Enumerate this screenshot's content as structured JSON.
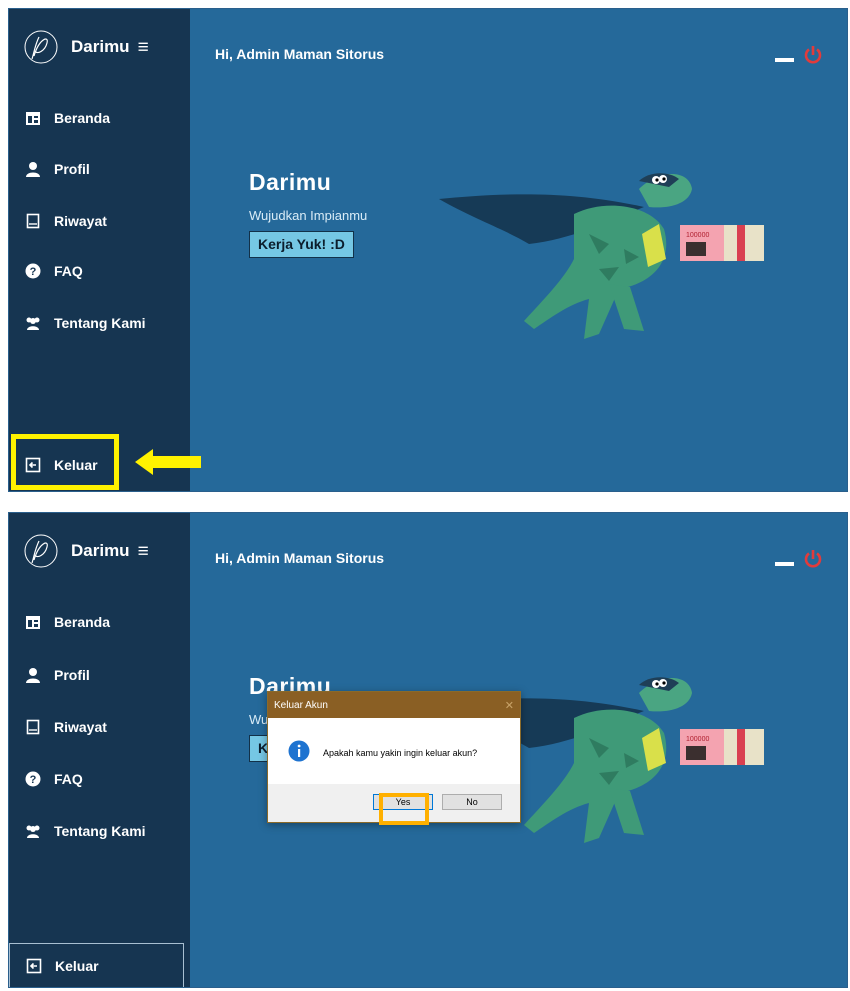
{
  "app": {
    "brand": "Darimu",
    "greeting": "Hi, Admin Maman Sitorus"
  },
  "sidebar": {
    "items": [
      {
        "label": "Beranda",
        "icon": "calendar-icon"
      },
      {
        "label": "Profil",
        "icon": "user-icon"
      },
      {
        "label": "Riwayat",
        "icon": "document-icon"
      },
      {
        "label": "FAQ",
        "icon": "question-icon"
      },
      {
        "label": "Tentang Kami",
        "icon": "users-icon"
      }
    ],
    "logout": "Keluar"
  },
  "hero": {
    "title": "Darimu",
    "subtitle": "Wujudkan Impianmu",
    "button": "Kerja Yuk! :D",
    "banknote_value": "100000"
  },
  "dialog": {
    "title": "Keluar Akun",
    "close": "✕",
    "message": "Apakah kamu yakin ingin keluar akun?",
    "yes": "Yes",
    "no": "No"
  },
  "colors": {
    "sidebar": "#163551",
    "main": "#25699a",
    "accent_button": "#75c7e4",
    "power_icon": "#e23b3b",
    "highlight_yellow": "#fff200",
    "highlight_orange": "#ffb000",
    "dialog_titlebar": "#8a5f24"
  }
}
